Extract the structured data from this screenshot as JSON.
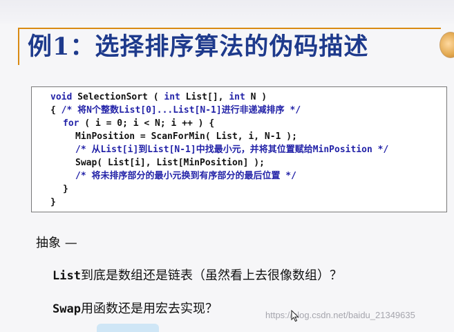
{
  "slide": {
    "title": "例1：选择排序算法的伪码描述"
  },
  "code": {
    "lines": [
      {
        "kw1": "void",
        "t1": " SelectionSort ( ",
        "kw2": "int",
        "t2": " List[], ",
        "kw3": "int",
        "t3": " N )"
      },
      {
        "t1": "{ ",
        "cm": "/* 将N个整数List[0]...List[N-1]进行非递减排序 */"
      },
      {
        "kw1": "for",
        "t1": " ( i = 0; i < N; i ++ ) {"
      },
      {
        "t1": "MinPosition = ScanForMin( List, i, N-1 );"
      },
      {
        "cm": "/* 从List[i]到List[N-1]中找最小元，并将其位置赋给MinPosition */"
      },
      {
        "t1": "Swap( List[i], List[MinPosition] );"
      },
      {
        "cm": "/* 将未排序部分的最小元换到有序部分的最后位置 */"
      },
      {
        "t1": "}"
      },
      {
        "t1": "}"
      }
    ]
  },
  "abstraction": {
    "label": "抽象 —",
    "q1_mono": "List",
    "q1_text": "到底是数组还是链表（虽然看上去很像数组）？",
    "q2_mono": "Swap",
    "q2_text": "用函数还是用宏去实现？"
  },
  "watermark": "https://blog.csdn.net/baidu_21349635"
}
